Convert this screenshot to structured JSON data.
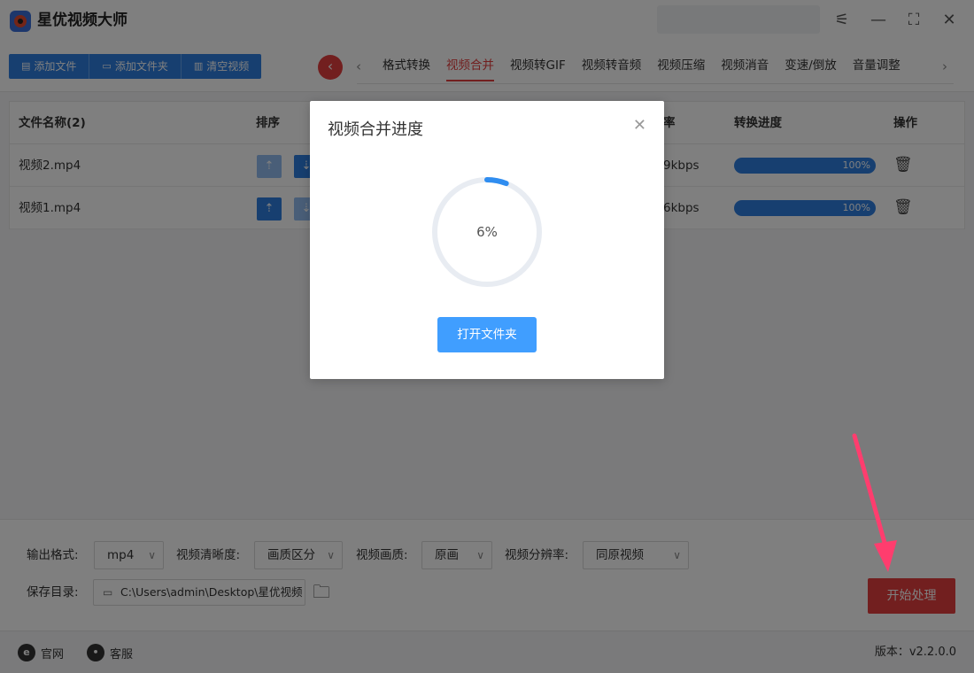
{
  "app": {
    "title": "星优视频大师"
  },
  "toolbar": {
    "add_file": "添加文件",
    "add_folder": "添加文件夹",
    "clear_videos": "清空视频"
  },
  "tabs": [
    {
      "label": "格式转换",
      "active": false
    },
    {
      "label": "视频合并",
      "active": true
    },
    {
      "label": "视频转GIF",
      "active": false
    },
    {
      "label": "视频转音频",
      "active": false
    },
    {
      "label": "视频压缩",
      "active": false
    },
    {
      "label": "视频消音",
      "active": false
    },
    {
      "label": "变速/倒放",
      "active": false
    },
    {
      "label": "音量调整",
      "active": false
    }
  ],
  "table": {
    "headers": {
      "name": "文件名称(2)",
      "sort": "排序",
      "bitrate_partial": "率",
      "progress": "转换进度",
      "actions": "操作"
    },
    "rows": [
      {
        "name": "视频2.mp4",
        "bitrate_partial": "9kbps",
        "progress": "100%"
      },
      {
        "name": "视频1.mp4",
        "bitrate_partial": "6kbps",
        "progress": "100%"
      }
    ]
  },
  "settings": {
    "output_format_label": "输出格式:",
    "output_format": "mp4",
    "clarity_label": "视频清晰度:",
    "clarity": "画质区分",
    "quality_label": "视频画质:",
    "quality": "原画",
    "resolution_label": "视频分辨率:",
    "resolution": "同原视频",
    "save_dir_label": "保存目录:",
    "save_dir": "C:\\Users\\admin\\Desktop\\星优视频",
    "start_button": "开始处理"
  },
  "footer": {
    "website": "官网",
    "support": "客服",
    "version": "版本：v2.2.0.0"
  },
  "dialog": {
    "title": "视频合并进度",
    "progress_text": "6%",
    "progress_value": 6,
    "open_folder": "打开文件夹"
  },
  "colors": {
    "primary_blue": "#2f7fe0",
    "accent_red": "#e53e3e",
    "dialog_blue": "#409eff",
    "annotation_pink": "#ff3d6e"
  }
}
